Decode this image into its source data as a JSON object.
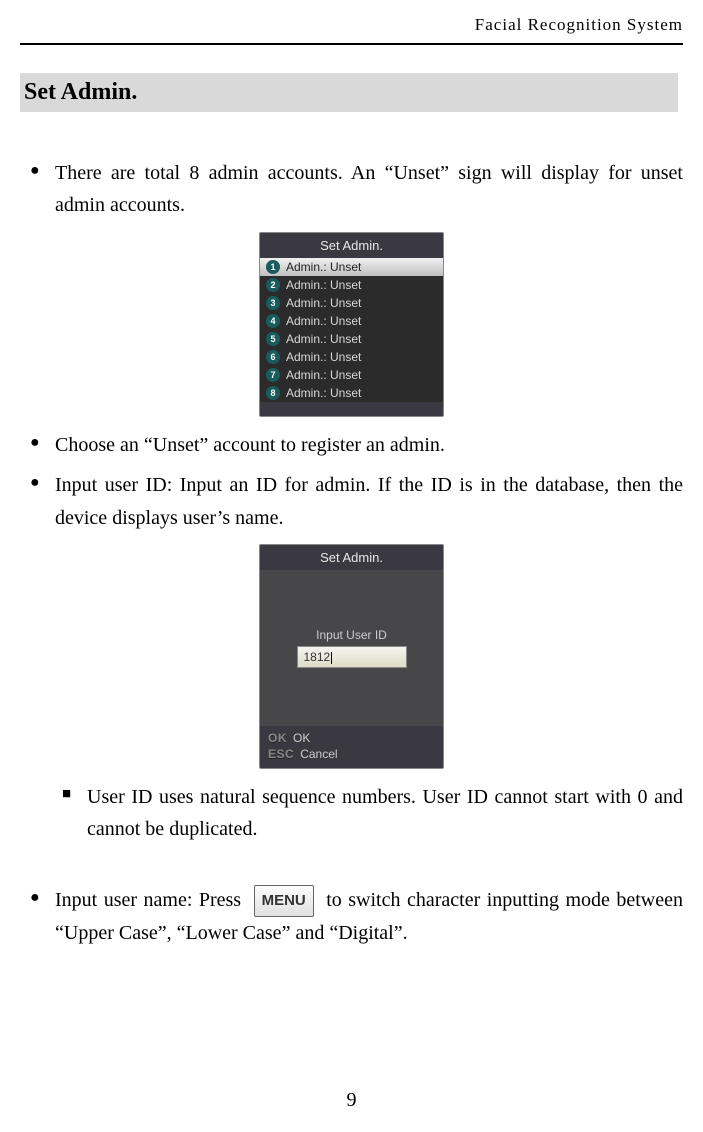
{
  "header": {
    "title": "Facial Recognition System"
  },
  "section": {
    "title": "Set Admin."
  },
  "bullets": {
    "b1": "There are total 8 admin accounts. An “Unset” sign will display for unset admin accounts.",
    "b2": "Choose an “Unset” account to register an admin.",
    "b3": "Input user ID: Input an ID for admin. If the ID is in the database, then the device displays user’s name.",
    "s1": "User ID uses natural sequence numbers. User ID cannot start with 0 and cannot be duplicated.",
    "b4_pre": "Input user name: Press ",
    "b4_key": "MENU",
    "b4_post": " to switch character inputting mode between “Upper Case”, “Lower Case” and “Digital”."
  },
  "device1": {
    "title": "Set Admin.",
    "rows": [
      {
        "n": "1",
        "label": "Admin.: Unset",
        "selected": true
      },
      {
        "n": "2",
        "label": "Admin.: Unset",
        "selected": false
      },
      {
        "n": "3",
        "label": "Admin.: Unset",
        "selected": false
      },
      {
        "n": "4",
        "label": "Admin.: Unset",
        "selected": false
      },
      {
        "n": "5",
        "label": "Admin.: Unset",
        "selected": false
      },
      {
        "n": "6",
        "label": "Admin.: Unset",
        "selected": false
      },
      {
        "n": "7",
        "label": "Admin.: Unset",
        "selected": false
      },
      {
        "n": "8",
        "label": "Admin.: Unset",
        "selected": false
      }
    ]
  },
  "device2": {
    "title": "Set Admin.",
    "input_label": "Input User ID",
    "input_value": "1812",
    "ok_key": "OK",
    "ok_label": "OK",
    "esc_key": "ESC",
    "esc_label": "Cancel"
  },
  "page_number": "9"
}
